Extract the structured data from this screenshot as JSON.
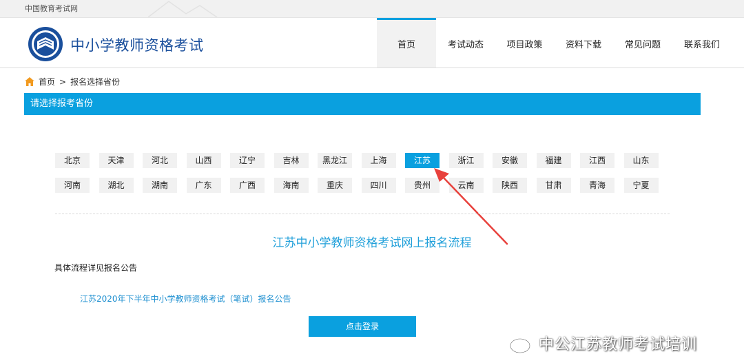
{
  "topbar": {
    "site_name": "中国教育考试网"
  },
  "header": {
    "brand": "中小学教师资格考试",
    "nav": [
      {
        "label": "首页",
        "active": true
      },
      {
        "label": "考试动态"
      },
      {
        "label": "项目政策"
      },
      {
        "label": "资料下载"
      },
      {
        "label": "常见问题"
      },
      {
        "label": "联系我们"
      }
    ]
  },
  "breadcrumb": {
    "home": "首页",
    "separator": ">",
    "current": "报名选择省份"
  },
  "province_bar": {
    "title": "请选择报考省份"
  },
  "provinces": {
    "row1": [
      "北京",
      "天津",
      "河北",
      "山西",
      "辽宁",
      "吉林",
      "黑龙江",
      "上海",
      "江苏",
      "浙江",
      "安徽",
      "福建",
      "江西",
      "山东"
    ],
    "row2": [
      "河南",
      "湖北",
      "湖南",
      "广东",
      "广西",
      "海南",
      "重庆",
      "四川",
      "贵州",
      "云南",
      "陕西",
      "甘肃",
      "青海",
      "宁夏"
    ],
    "selected": "江苏"
  },
  "flow": {
    "title": "江苏中小学教师资格考试网上报名流程",
    "detail_label": "具体流程详见报名公告",
    "notice_link": "江苏2020年下半年中小学教师资格考试（笔试）报名公告",
    "login_button": "点击登录"
  },
  "watermark": {
    "text": "中公江苏教师考试培训"
  },
  "colors": {
    "accent": "#0aa0df",
    "brand_text": "#1a4f9c",
    "link": "#1d8fd0",
    "arrow": "#e8413c"
  }
}
